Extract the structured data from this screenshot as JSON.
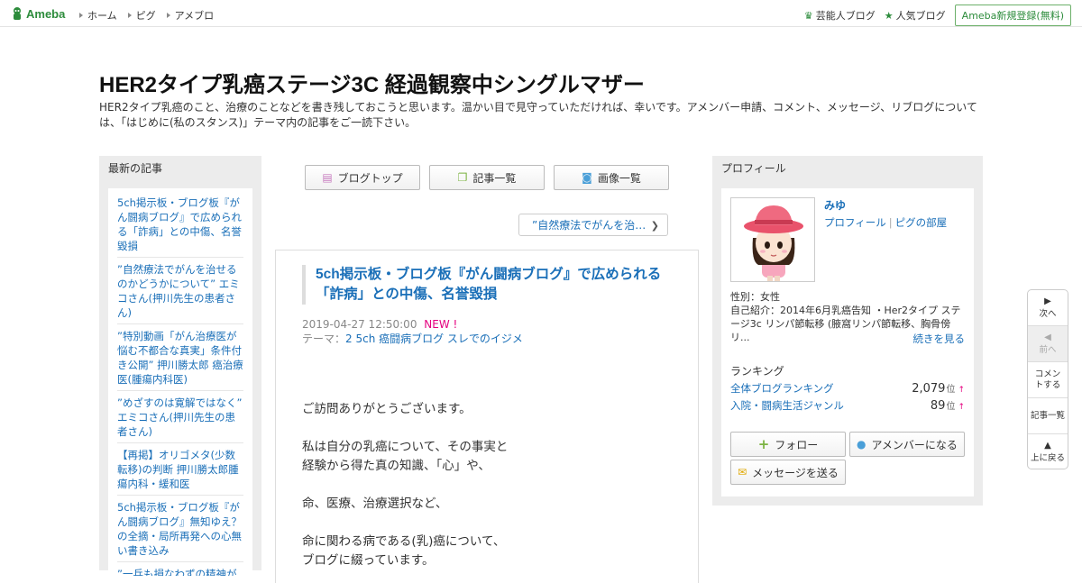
{
  "topbar": {
    "logo_text": "Ameba",
    "nav": [
      "ホーム",
      "ピグ",
      "アメブロ"
    ],
    "celebrity_label": "芸能人ブログ",
    "popular_label": "人気ブログ",
    "register_label": "Ameba新規登録(無料)"
  },
  "blog": {
    "title": "HER2タイプ乳癌ステージ3C 経過観察中シングルマザー",
    "description": "HER2タイプ乳癌のこと、治療のことなどを書き残しておこうと思います。温かい目で見守っていただければ、幸いです。アメンバー申請、コメント、メッセージ、リブログについては、「はじめに(私のスタンス)」テーマ内の記事をご一読下さい。"
  },
  "left_sidebar": {
    "heading": "最新の記事",
    "items": [
      "5ch掲示板・ブログ板『がん闘病ブログ』で広められる「詐病」との中傷、名誉毀損",
      "”自然療法でがんを治せるのかどうかについて” エミコさん(押川先生の患者さん)",
      "”特別動画「がん治療医が悩む不都合な真実」条件付き公開” 押川勝太郎 癌治療医(腫瘍内科医)",
      "”めざすのは寛解ではなく” エミコさん(押川先生の患者さん)",
      "【再掲】オリゴメタ(少数転移)の判断 押川勝太郎腫瘍内科・緩和医",
      "5ch掲示板・ブログ板『がん闘病ブログ』無知ゆえ？の全摘・局所再発への心無い書き込み",
      "”一兵も損なわずの精神が"
    ]
  },
  "toolbar": {
    "blog_top": "ブログトップ",
    "article_list": "記事一覧",
    "image_list": "画像一覧"
  },
  "prev_article": "”自然療法でがんを治…",
  "article": {
    "title": "5ch掲示板・ブログ板『がん闘病ブログ』で広められる「詐病」との中傷、名誉毀損",
    "date": "2019-04-27 12:50:00",
    "new_badge": "NEW !",
    "theme_label": "テーマ：",
    "theme": "2 5ch 癌闘病ブログ スレでのイジメ",
    "body": [
      "ご訪問ありがとうございます。",
      "",
      "私は自分の乳癌について、その事実と",
      "経験から得た真の知識、「心」や、",
      "",
      "命、医療、治療選択など、",
      "",
      "命に関わる病である(乳)癌について、",
      "ブログに綴っています。"
    ]
  },
  "profile": {
    "heading": "プロフィール",
    "name": "みゆ",
    "profile_link": "プロフィール",
    "pigg_link": "ピグの部屋",
    "gender": "性別：女性",
    "intro": "自己紹介：2014年6月乳癌告知 ・Her2タイプ ステージ3c リンパ節転移 (腋窩リンパ節転移、胸骨傍リ...",
    "more": "続きを見る",
    "ranking_heading": "ランキング",
    "rankings": [
      {
        "label": "全体ブログランキング",
        "value": "2,079",
        "unit": "位",
        "arrow": "↑"
      },
      {
        "label": "入院・闘病生活ジャンル",
        "value": "89",
        "unit": "位",
        "arrow": "↑"
      }
    ],
    "follow_label": "フォロー",
    "amember_label": "アメンバーになる",
    "message_label": "メッセージを送る"
  },
  "floatnav": {
    "next": "次へ",
    "prev": "前へ",
    "comment": "コメントする",
    "list": "記事一覧",
    "top": "上に戻る"
  }
}
